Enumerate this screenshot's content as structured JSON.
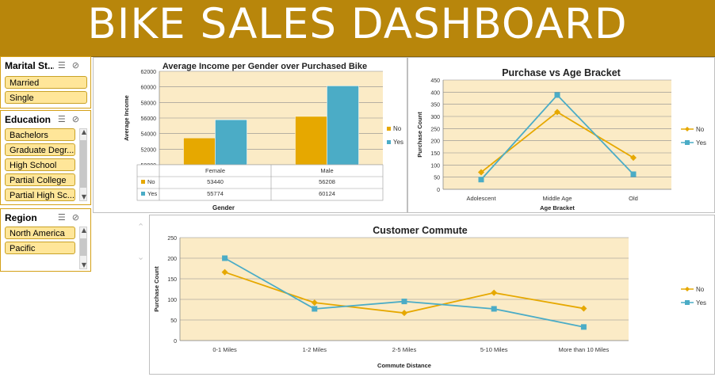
{
  "header": {
    "title": "BIKE SALES DASHBOARD"
  },
  "slicers": {
    "marital": {
      "title": "Marital St...",
      "items": [
        "Married",
        "Single"
      ]
    },
    "education": {
      "title": "Education",
      "items": [
        "Bachelors",
        "Graduate Degr...",
        "High School",
        "Partial College",
        "Partial High Sc..."
      ]
    },
    "region": {
      "title": "Region",
      "items": [
        "North America",
        "Pacific"
      ]
    }
  },
  "colors": {
    "banner": "#b8860b",
    "no": "#e6a800",
    "yes": "#4bacc6",
    "plot_bg": "#fbebc6",
    "slicer_item": "#ffe699"
  },
  "chart_data": [
    {
      "type": "bar",
      "title": "Average Income per Gender over Purchased Bike",
      "xlabel": "Gender",
      "ylabel": "Average Income",
      "categories": [
        "Female",
        "Male"
      ],
      "series": [
        {
          "name": "No",
          "values": [
            53440,
            56208
          ]
        },
        {
          "name": "Yes",
          "values": [
            55774,
            60124
          ]
        }
      ],
      "ylim": [
        50000,
        62000
      ],
      "yticks": [
        "50000",
        "52000",
        "54000",
        "56000",
        "58000",
        "60000",
        "62000"
      ],
      "table": {
        "No": [
          "53440",
          "56208"
        ],
        "Yes": [
          "55774",
          "60124"
        ]
      },
      "legend": "right"
    },
    {
      "type": "line",
      "title": "Purchase  vs Age Bracket",
      "xlabel": "Age Bracket",
      "ylabel": "Purchase Count",
      "categories": [
        "Adolescent",
        "Middle Age",
        "Old"
      ],
      "series": [
        {
          "name": "No",
          "values": [
            70,
            318,
            130
          ]
        },
        {
          "name": "Yes",
          "values": [
            40,
            388,
            62
          ]
        }
      ],
      "ylim": [
        0,
        450
      ],
      "yticks": [
        "0",
        "50",
        "100",
        "150",
        "200",
        "250",
        "300",
        "350",
        "400",
        "450"
      ],
      "legend": "right"
    },
    {
      "type": "line",
      "title": "Customer Commute",
      "xlabel": "Commute Distance",
      "ylabel": "Purchase Count",
      "categories": [
        "0-1 Miles",
        "1-2 Miles",
        "2-5 Miles",
        "5-10 Miles",
        "More than 10 Miles"
      ],
      "series": [
        {
          "name": "No",
          "values": [
            166,
            92,
            67,
            116,
            78
          ]
        },
        {
          "name": "Yes",
          "values": [
            200,
            77,
            95,
            77,
            33
          ]
        }
      ],
      "ylim": [
        0,
        250
      ],
      "yticks": [
        "0",
        "50",
        "100",
        "150",
        "200",
        "250"
      ],
      "legend": "right"
    }
  ]
}
